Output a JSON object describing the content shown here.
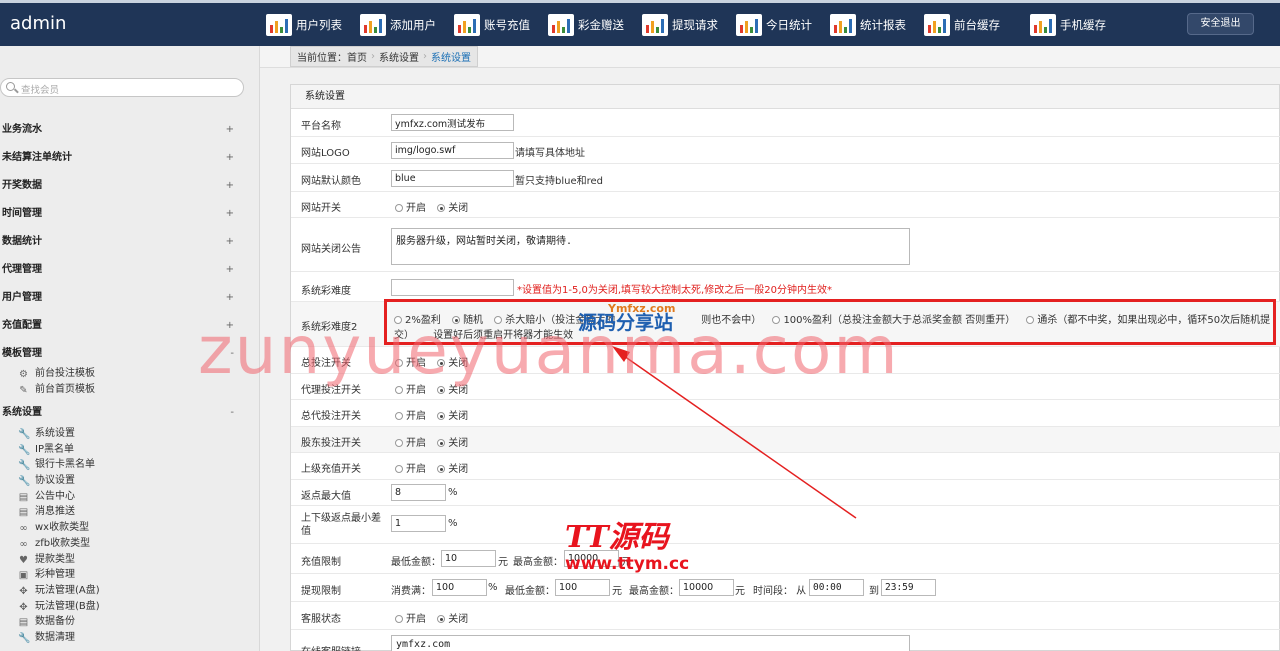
{
  "app": {
    "brand": "admin",
    "logout_label": "安全退出"
  },
  "nav": [
    {
      "label": "用户列表"
    },
    {
      "label": "添加用户"
    },
    {
      "label": "账号充值"
    },
    {
      "label": "彩金赠送"
    },
    {
      "label": "提现请求"
    },
    {
      "label": "今日统计"
    },
    {
      "label": "统计报表"
    },
    {
      "label": "前台缓存"
    },
    {
      "label": "手机缓存"
    }
  ],
  "sidebar": {
    "search_placeholder": "查找会员",
    "groups": [
      {
        "label": "业务流水",
        "toggle": "+"
      },
      {
        "label": "未结算注单统计",
        "toggle": "+"
      },
      {
        "label": "开奖数据",
        "toggle": "+"
      },
      {
        "label": "时间管理",
        "toggle": "+"
      },
      {
        "label": "数据统计",
        "toggle": "+"
      },
      {
        "label": "代理管理",
        "toggle": "+"
      },
      {
        "label": "用户管理",
        "toggle": "+"
      },
      {
        "label": "充值配置",
        "toggle": "+"
      },
      {
        "label": "模板管理",
        "toggle": "-"
      },
      {
        "label": "系统设置",
        "toggle": "-"
      }
    ],
    "template_items": [
      {
        "label": "前台投注模板",
        "icon": "gear-icon"
      },
      {
        "label": "前台首页模板",
        "icon": "edit-icon"
      }
    ],
    "system_items": [
      {
        "label": "系统设置",
        "icon": "wrench-icon"
      },
      {
        "label": "IP黑名单",
        "icon": "wrench-icon"
      },
      {
        "label": "银行卡黑名单",
        "icon": "wrench-icon"
      },
      {
        "label": "协议设置",
        "icon": "wrench-icon"
      },
      {
        "label": "公告中心",
        "icon": "doc-icon"
      },
      {
        "label": "消息推送",
        "icon": "doc-icon"
      },
      {
        "label": "wx收款类型",
        "icon": "link-icon"
      },
      {
        "label": "zfb收款类型",
        "icon": "link-icon"
      },
      {
        "label": "提款类型",
        "icon": "heart-icon"
      },
      {
        "label": "彩种管理",
        "icon": "box-icon"
      },
      {
        "label": "玩法管理(A盘)",
        "icon": "gamepad-icon"
      },
      {
        "label": "玩法管理(B盘)",
        "icon": "gamepad-icon"
      },
      {
        "label": "数据备份",
        "icon": "doc-icon"
      },
      {
        "label": "数据清理",
        "icon": "wrench-icon"
      }
    ]
  },
  "breadcrumb": {
    "prefix": "当前位置：首页",
    "mid": "系统设置",
    "current": "系统设置"
  },
  "panel": {
    "title": "系统设置"
  },
  "radio_labels": {
    "on": "开启",
    "off": "关闭"
  },
  "form": {
    "platform_name": {
      "label": "平台名称",
      "value": "ymfxz.com测试发布"
    },
    "logo": {
      "label": "网站LOGO",
      "value": "img/logo.swf",
      "hint": "请填写具体地址"
    },
    "color": {
      "label": "网站默认颜色",
      "value": "blue",
      "hint": "暂只支持blue和red"
    },
    "site_switch": {
      "label": "网站开关"
    },
    "close_notice": {
      "label": "网站关闭公告",
      "value": "服务器升级，网站暂时关闭，敬请期待."
    },
    "difficulty": {
      "label": "系统彩难度",
      "value": "",
      "hint": "*设置值为1-5,0为关闭,填写较大控制太死,修改之后一般20分钟内生效*"
    },
    "difficulty2": {
      "label": "系统彩难度2",
      "opt1": "2%盈利",
      "opt2": "随机",
      "opt3": "杀大赔小（投注金额大的",
      "opt3b": "则也不会中）",
      "opt4": "100%盈利（总投注金额大于总派奖金额 否则重开）",
      "opt5": "通杀（都不中奖，如果出现必中，循环50次后随机提",
      "line2a": "交）",
      "line2b": "设置好后须重启开将器才能生效"
    },
    "bet_switch": {
      "label": "总投注开关"
    },
    "agent_bet": {
      "label": "代理投注开关"
    },
    "general_agent_bet": {
      "label": "总代投注开关"
    },
    "shareholder_bet": {
      "label": "股东投注开关"
    },
    "upper_recharge": {
      "label": "上级充值开关"
    },
    "rebate_max": {
      "label": "返点最大值",
      "value": "8",
      "unit": "%"
    },
    "rebate_diff": {
      "label": "上下级返点最小差值",
      "value": "1",
      "unit": "%"
    },
    "recharge_limit": {
      "label": "充值限制",
      "min_label": "最低金额：",
      "min": "10",
      "yuan": "元",
      "max_label": "最高金额：",
      "max": "10000"
    },
    "withdraw_limit": {
      "label": "提现限制",
      "consume_label": "消费满：",
      "consume": "100",
      "pct": "%",
      "min_label": "最低金额：",
      "min": "100",
      "yuan": "元",
      "max_label": "最高金额：",
      "max": "10000",
      "time_label": "时间段： 从",
      "from": "00:00",
      "to_label": "到",
      "to": "23:59"
    },
    "service_status": {
      "label": "客服状态"
    },
    "service_link": {
      "label": "在线客服链接",
      "value": "ymfxz.com"
    }
  },
  "watermarks": {
    "big": "zunyueyuanma.com",
    "logo_top": "Ymfxz.com",
    "logo": "源码分享站",
    "tt": "TT源码",
    "url": "www.ttym.cc"
  },
  "colors": {
    "topbar": "#1f3557",
    "accent_red": "#e42020",
    "link_blue": "#1a6fb5"
  }
}
